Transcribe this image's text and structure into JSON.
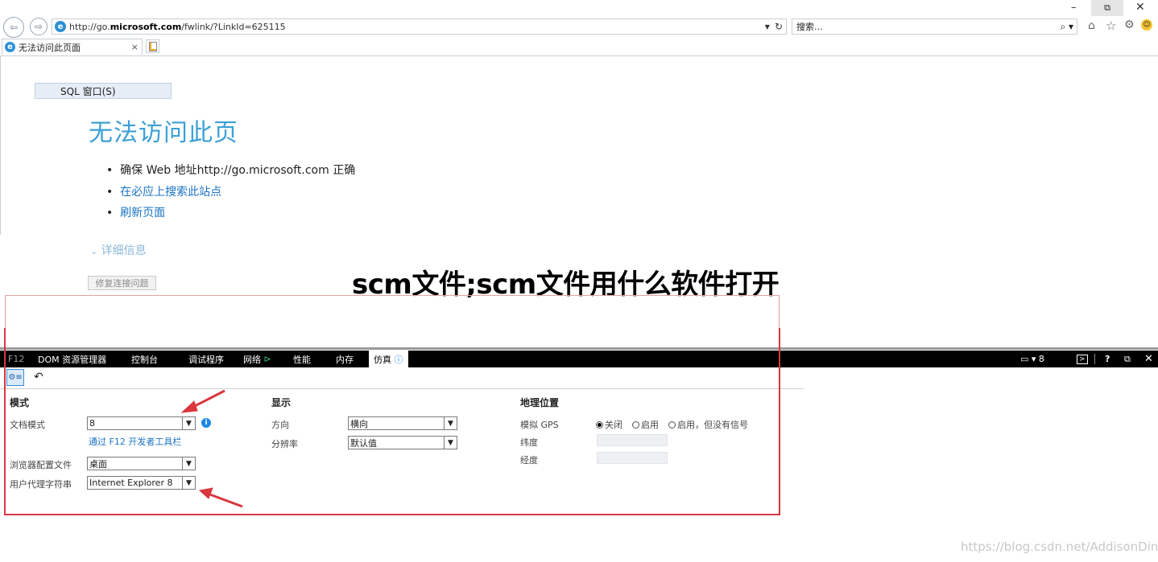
{
  "browser": {
    "url_prefix": "http://go.",
    "url_domain": "microsoft.com",
    "url_suffix": "/fwlink/?LinkId=625115",
    "search_placeholder": "搜索...",
    "tab_title": "无法访问此页面"
  },
  "page": {
    "sql_button": "SQL 窗口(S)",
    "title": "无法访问此页",
    "bullets": [
      "确保 Web 地址http://go.microsoft.com 正确",
      "在必应上搜索此站点",
      "刷新页面"
    ],
    "details": "详细信息",
    "fix_button": "修复连接问题",
    "overlay_title": "scm文件;scm文件用什么软件打开"
  },
  "devtools": {
    "tabs": [
      "F12",
      "DOM 资源管理器",
      "控制台",
      "调试程序",
      "网络",
      "性能",
      "内存",
      "仿真"
    ],
    "right_num": "8",
    "mode": {
      "header": "模式",
      "doc_mode_label": "文档模式",
      "doc_mode_value": "8",
      "toolbar_link": "通过 F12 开发者工具栏",
      "browser_profile_label": "浏览器配置文件",
      "browser_profile_value": "桌面",
      "ua_label": "用户代理字符串",
      "ua_value": "Internet Explorer 8"
    },
    "display": {
      "header": "显示",
      "orientation_label": "方向",
      "orientation_value": "横向",
      "resolution_label": "分辨率",
      "resolution_value": "默认值"
    },
    "geo": {
      "header": "地理位置",
      "gps_label": "模拟 GPS",
      "options": [
        "关闭",
        "启用",
        "启用，但没有信号"
      ],
      "lat_label": "纬度",
      "lon_label": "经度"
    }
  },
  "watermark": "https://blog.csdn.net/AddisonDing",
  "colors": {
    "accent": "#3ca0d6",
    "annotation": "#d9363e",
    "devtools_bar": "#000000"
  }
}
